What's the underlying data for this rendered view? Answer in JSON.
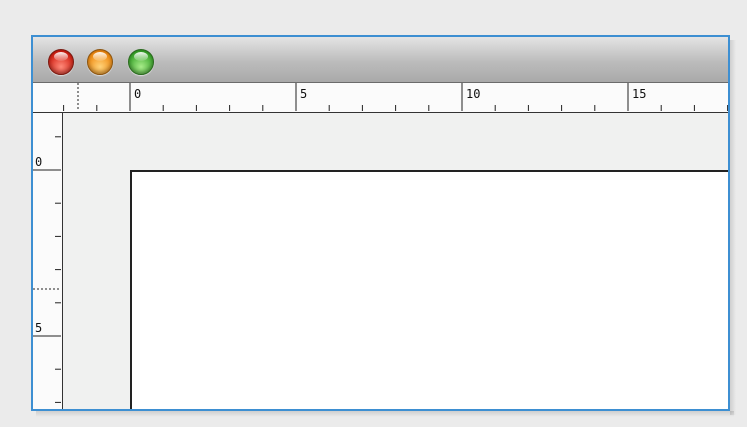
{
  "window": {
    "buttons": [
      {
        "name": "close",
        "color": "#d21f12"
      },
      {
        "name": "minimize",
        "color": "#f08a10"
      },
      {
        "name": "zoom",
        "color": "#39a52a"
      }
    ]
  },
  "horizontal_ruler": {
    "labels": [
      "0",
      "5",
      "10",
      "15"
    ]
  },
  "vertical_ruler": {
    "labels": [
      "0",
      "5"
    ]
  },
  "colors": {
    "frame_border": "#3d8fd2",
    "canvas_background": "#f0f1f0",
    "page_background": "#ffffff"
  }
}
